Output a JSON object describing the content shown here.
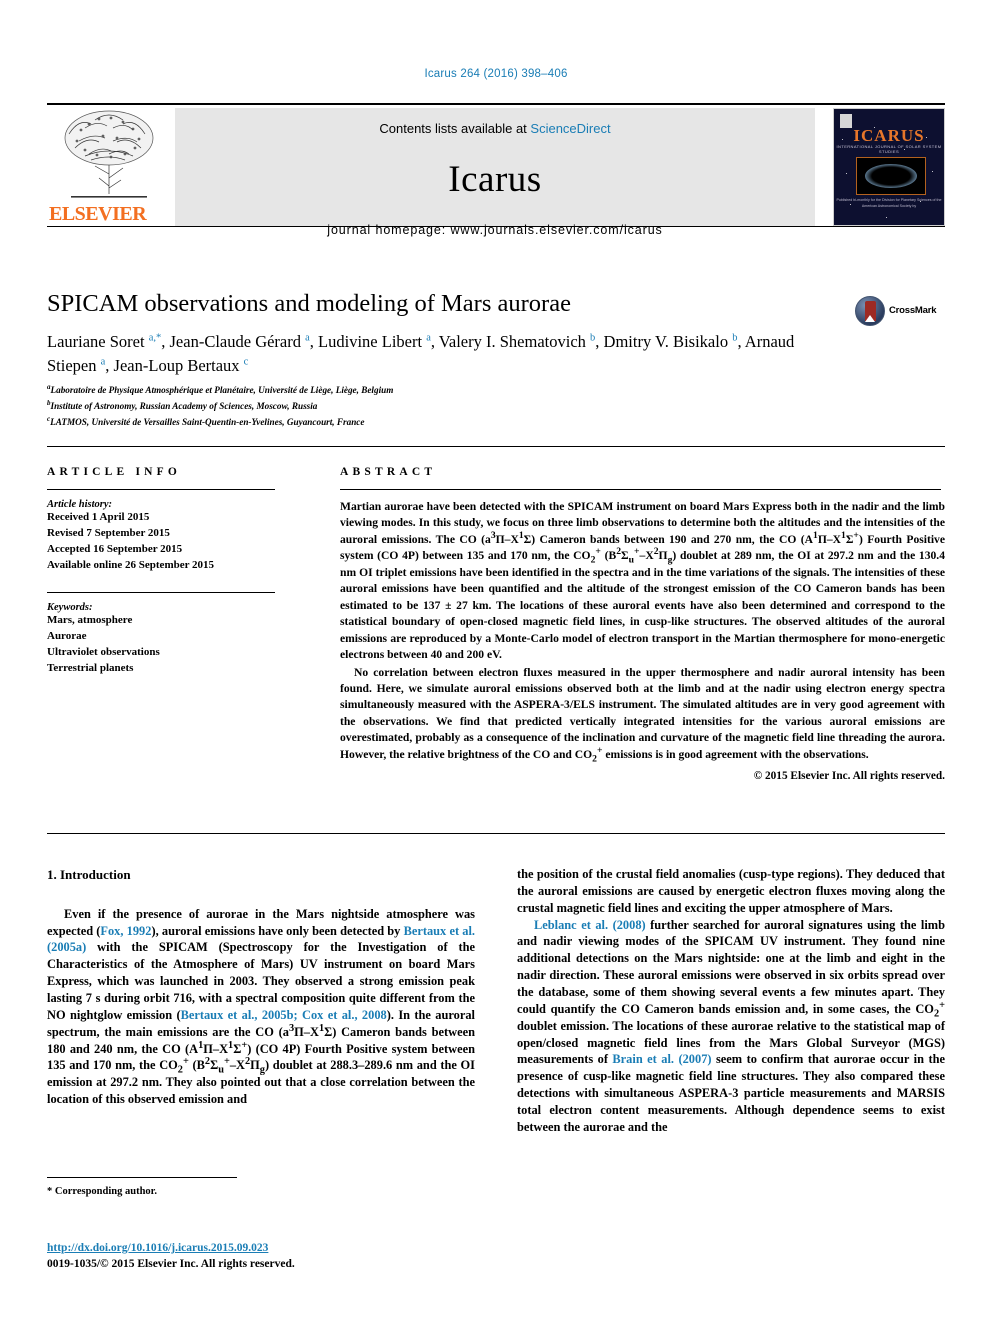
{
  "running_head": "Icarus 264 (2016) 398–406",
  "masthead": {
    "publisher": "ELSEVIER",
    "contents_prefix": "Contents lists available at ",
    "sciencedirect": "ScienceDirect",
    "journal_name": "Icarus",
    "homepage": "journal homepage: www.journals.elsevier.com/icarus",
    "cover": {
      "title": "ICARUS",
      "subtitle": "INTERNATIONAL JOURNAL OF SOLAR SYSTEM STUDIES",
      "caption": "Published bi-monthly for the Division for Planetary Sciences of the American Astronomical Society by"
    }
  },
  "article": {
    "title": "SPICAM observations and modeling of Mars aurorae",
    "crossmark_label": "CrossMark",
    "authors_html": "Lauriane Soret <sup class=\"sup\">a,*</sup>, Jean-Claude Gérard <sup class=\"sup\">a</sup>, Ludivine Libert <sup class=\"sup\">a</sup>, Valery I. Shematovich <sup class=\"sup\">b</sup>, Dmitry V. Bisikalo <sup class=\"sup\">b</sup>, Arnaud Stiepen <sup class=\"sup\">a</sup>, Jean-Loup Bertaux <sup class=\"sup\">c</sup>",
    "affiliations": [
      {
        "label": "a",
        "text": "Laboratoire de Physique Atmosphérique et Planétaire, Université de Liège, Liège, Belgium"
      },
      {
        "label": "b",
        "text": "Institute of Astronomy, Russian Academy of Sciences, Moscow, Russia"
      },
      {
        "label": "c",
        "text": "LATMOS, Université de Versailles Saint-Quentin-en-Yvelines, Guyancourt, France"
      }
    ]
  },
  "article_info": {
    "heading": "ARTICLE INFO",
    "history_title": "Article history:",
    "history": [
      "Received 1 April 2015",
      "Revised 7 September 2015",
      "Accepted 16 September 2015",
      "Available online 26 September 2015"
    ],
    "keywords_title": "Keywords:",
    "keywords": [
      "Mars, atmosphere",
      "Aurorae",
      "Ultraviolet observations",
      "Terrestrial planets"
    ]
  },
  "abstract": {
    "heading": "ABSTRACT",
    "paragraph1_html": "Martian aurorae have been detected with the SPICAM instrument on board Mars Express both in the nadir and the limb viewing modes. In this study, we focus on three limb observations to determine both the altitudes and the intensities of the auroral emissions. The CO (a<sup>3</sup>Π–X<sup>1</sup>Σ) Cameron bands between 190 and 270 nm, the CO (A<sup>1</sup>Π–X<sup>1</sup>Σ<sup>+</sup>) Fourth Positive system (CO 4P) between 135 and 170 nm, the CO<sub>2</sub><sup>+</sup> (B<sup>2</sup>Σ<sub>u</sub><sup>+</sup>–X<sup>2</sup>Π<sub>g</sub>) doublet at 289 nm, the OI at 297.2 nm and the 130.4 nm OI triplet emissions have been identified in the spectra and in the time variations of the signals. The intensities of these auroral emissions have been quantified and the altitude of the strongest emission of the CO Cameron bands has been estimated to be 137 ± 27 km. The locations of these auroral events have also been determined and correspond to the statistical boundary of open-closed magnetic field lines, in cusp-like structures. The observed altitudes of the auroral emissions are reproduced by a Monte-Carlo model of electron transport in the Martian thermosphere for mono-energetic electrons between 40 and 200 eV.",
    "paragraph2_html": "No correlation between electron fluxes measured in the upper thermosphere and nadir auroral intensity has been found. Here, we simulate auroral emissions observed both at the limb and at the nadir using electron energy spectra simultaneously measured with the ASPERA-3/ELS instrument. The simulated altitudes are in very good agreement with the observations. We find that predicted vertically integrated intensities for the various auroral emissions are overestimated, probably as a consequence of the inclination and curvature of the magnetic field line threading the aurora. However, the relative brightness of the CO and CO<sub>2</sub><sup>+</sup> emissions is in good agreement with the observations.",
    "copyright": "© 2015 Elsevier Inc. All rights reserved."
  },
  "body": {
    "section_heading": "1. Introduction",
    "left_paragraph_html": "Even if the presence of aurorae in the Mars nightside atmosphere was expected (<span class=\"cite\">Fox, 1992</span>), auroral emissions have only been detected by <span class=\"cite\">Bertaux et al. (2005a)</span> with the SPICAM (Spectroscopy for the Investigation of the Characteristics of the Atmosphere of Mars) UV instrument on board Mars Express, which was launched in 2003. They observed a strong emission peak lasting 7 s during orbit 716, with a spectral composition quite different from the NO nightglow emission (<span class=\"cite\">Bertaux et al., 2005b; Cox et al., 2008</span>). In the auroral spectrum, the main emissions are the CO (a<sup>3</sup>Π–X<sup>1</sup>Σ) Cameron bands between 180 and 240 nm, the CO (A<sup>1</sup>Π–X<sup>1</sup>Σ<sup>+</sup>) (CO 4P) Fourth Positive system between 135 and 170 nm, the CO<sub>2</sub><sup>+</sup> (B<sup>2</sup>Σ<sub>u</sub><sup>+</sup>–X<sup>2</sup>Π<sub>g</sub>) doublet at 288.3–289.6 nm and the OI emission at 297.2 nm. They also pointed out that a close correlation between the location of this observed emission and",
    "right_paragraph1_html": "the position of the crustal field anomalies (cusp-type regions). They deduced that the auroral emissions are caused by energetic electron fluxes moving along the crustal magnetic field lines and exciting the upper atmosphere of Mars.",
    "right_paragraph2_html": "<span class=\"cite\">Leblanc et al. (2008)</span> further searched for auroral signatures using the limb and nadir viewing modes of the SPICAM UV instrument. They found nine additional detections on the Mars nightside: one at the limb and eight in the nadir direction. These auroral emissions were observed in six orbits spread over the database, some of them showing several events a few minutes apart. They could quantify the CO Cameron bands emission and, in some cases, the CO<sub>2</sub><sup>+</sup> doublet emission. The locations of these aurorae relative to the statistical map of open/closed magnetic field lines from the Mars Global Surveyor (MGS) measurements of <span class=\"cite\">Brain et al. (2007)</span> seem to confirm that aurorae occur in the presence of cusp-like magnetic field line structures. They also compared these detections with simultaneous ASPERA-3 particle measurements and MARSIS total electron content measurements. Although dependence seems to exist between the aurorae and the"
  },
  "footer": {
    "corresponding": "* Corresponding author.",
    "doi": "http://dx.doi.org/10.1016/j.icarus.2015.09.023",
    "issn": "0019-1035/© 2015 Elsevier Inc. All rights reserved."
  },
  "colors": {
    "link_blue": "#1a7db5",
    "elsevier_orange": "#f36f21",
    "cover_navy": "#0d1030"
  }
}
